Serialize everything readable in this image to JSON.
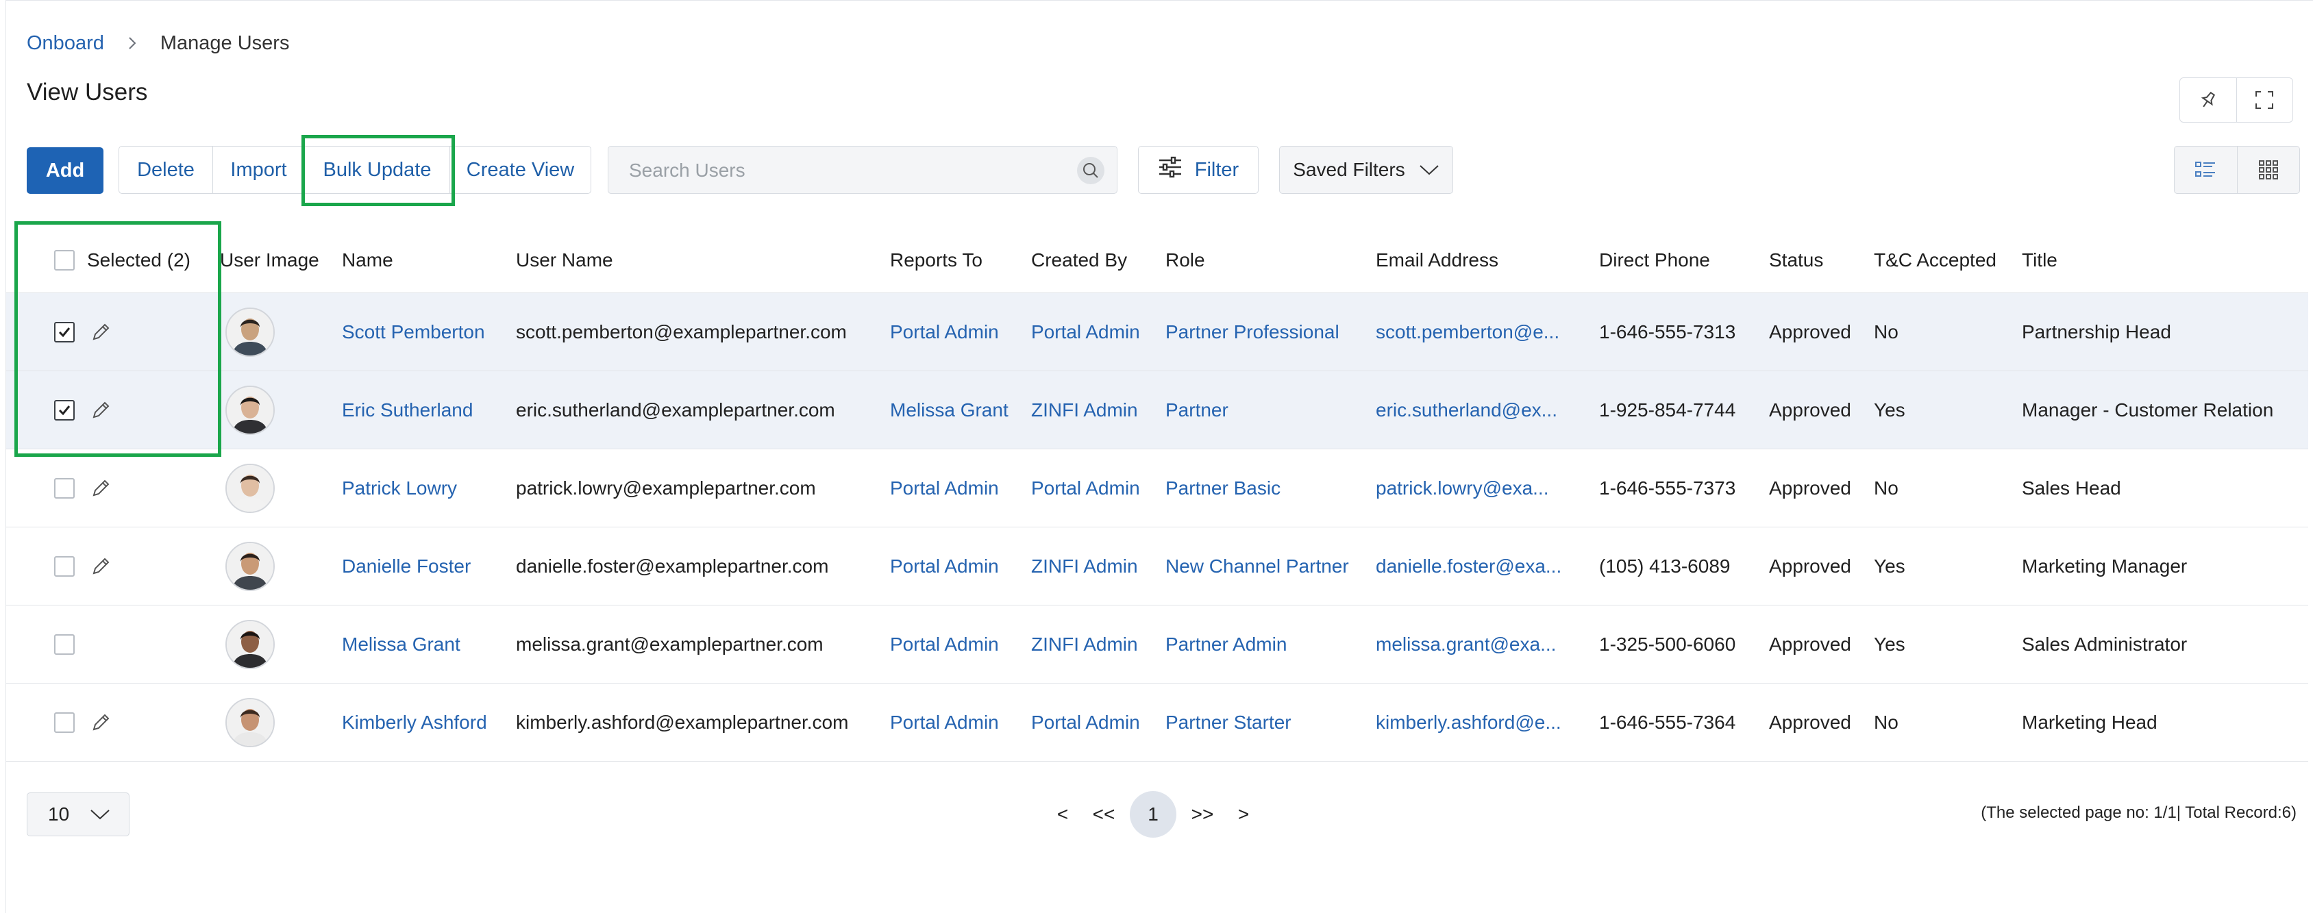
{
  "breadcrumb": {
    "root": "Onboard",
    "current": "Manage Users"
  },
  "page_title": "View Users",
  "toolbar": {
    "add": "Add",
    "delete": "Delete",
    "import": "Import",
    "bulk_update": "Bulk Update",
    "create_view": "Create View",
    "search_placeholder": "Search Users",
    "filter": "Filter",
    "saved_filters": "Saved Filters"
  },
  "table": {
    "headers": {
      "selected": "Selected (2)",
      "user_image": "User Image",
      "name": "Name",
      "user_name": "User Name",
      "reports_to": "Reports To",
      "created_by": "Created By",
      "role": "Role",
      "email": "Email Address",
      "phone": "Direct Phone",
      "status": "Status",
      "tnc": "T&C Accepted",
      "title": "Title"
    },
    "rows": [
      {
        "checked": true,
        "editable": true,
        "name": "Scott Pemberton",
        "user_name": "scott.pemberton@examplepartner.com",
        "reports_to": "Portal Admin",
        "created_by": "Portal Admin",
        "role": "Partner Professional",
        "email": "scott.pemberton@e...",
        "phone": "1-646-555-7313",
        "status": "Approved",
        "tnc": "No",
        "title": "Partnership Head",
        "skin": "#c9a27f",
        "hair": "#2b2420",
        "shirt": "#3f4c5a"
      },
      {
        "checked": true,
        "editable": true,
        "name": "Eric Sutherland",
        "user_name": "eric.sutherland@examplepartner.com",
        "reports_to": "Melissa Grant",
        "created_by": "ZINFI Admin",
        "role": "Partner",
        "email": "eric.sutherland@ex...",
        "phone": "1-925-854-7744",
        "status": "Approved",
        "tnc": "Yes",
        "title": "Manager - Customer Relation",
        "skin": "#d9b295",
        "hair": "#1d1a18",
        "shirt": "#2f2f33"
      },
      {
        "checked": false,
        "editable": true,
        "name": "Patrick Lowry",
        "user_name": "patrick.lowry@examplepartner.com",
        "reports_to": "Portal Admin",
        "created_by": "Portal Admin",
        "role": "Partner Basic",
        "email": "patrick.lowry@exa...",
        "phone": "1-646-555-7373",
        "status": "Approved",
        "tnc": "No",
        "title": "Sales Head",
        "skin": "#e0bea3",
        "hair": "#3a2b22",
        "shirt": "#f2f2f2"
      },
      {
        "checked": false,
        "editable": true,
        "name": "Danielle Foster",
        "user_name": "danielle.foster@examplepartner.com",
        "reports_to": "Portal Admin",
        "created_by": "ZINFI Admin",
        "role": "New Channel Partner",
        "email": "danielle.foster@exa...",
        "phone": "(105) 413-6089",
        "status": "Approved",
        "tnc": "Yes",
        "title": "Marketing Manager",
        "skin": "#c99a76",
        "hair": "#2a201b",
        "shirt": "#40464e"
      },
      {
        "checked": false,
        "editable": false,
        "name": "Melissa Grant",
        "user_name": "melissa.grant@examplepartner.com",
        "reports_to": "Portal Admin",
        "created_by": "ZINFI Admin",
        "role": "Partner Admin",
        "email": "melissa.grant@exa...",
        "phone": "1-325-500-6060",
        "status": "Approved",
        "tnc": "Yes",
        "title": "Sales Administrator",
        "skin": "#8d5f45",
        "hair": "#1a1412",
        "shirt": "#2d2d30"
      },
      {
        "checked": false,
        "editable": true,
        "name": "Kimberly Ashford",
        "user_name": "kimberly.ashford@examplepartner.com",
        "reports_to": "Portal Admin",
        "created_by": "Portal Admin",
        "role": "Partner Starter",
        "email": "kimberly.ashford@e...",
        "phone": "1-646-555-7364",
        "status": "Approved",
        "tnc": "No",
        "title": "Marketing Head",
        "skin": "#c69373",
        "hair": "#3b2a20",
        "shirt": "#e9e9e9"
      }
    ]
  },
  "pagination": {
    "page_size": "10",
    "prev": "<",
    "first": "<<",
    "current": "1",
    "last": ">>",
    "next": ">",
    "summary": "(The selected page no: 1/1| Total Record:6)"
  },
  "colors": {
    "primary": "#1e63b4",
    "link": "#2563b0",
    "highlight": "#1aa64b",
    "selected_row": "#eef2f8"
  }
}
